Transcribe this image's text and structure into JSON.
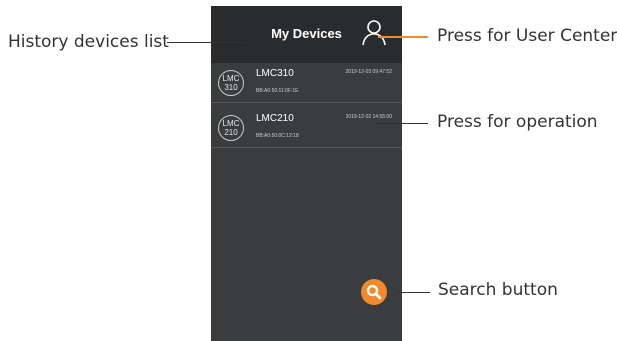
{
  "app": {
    "title": "My Devices"
  },
  "devices": [
    {
      "badge_line1": "LMC",
      "badge_line2": "310",
      "name": "LMC310",
      "timestamp": "2019-12-03 09:47:52",
      "mac": "BB:A0:50:11:0F:1E"
    },
    {
      "badge_line1": "LMC",
      "badge_line2": "210",
      "name": "LMC210",
      "timestamp": "2019-12-02 14:55:00",
      "mac": "BB:A0:50:0C:12:18"
    }
  ],
  "icons": {
    "user": "user-icon",
    "search": "search-icon"
  },
  "colors": {
    "accent": "#f08a2c",
    "screen_bg": "#3b3c3e",
    "header_bg": "#2a2b2d"
  },
  "callouts": {
    "history": "History devices list",
    "user_center": "Press for User Center",
    "operation": "Press for operation",
    "search": "Search button"
  }
}
